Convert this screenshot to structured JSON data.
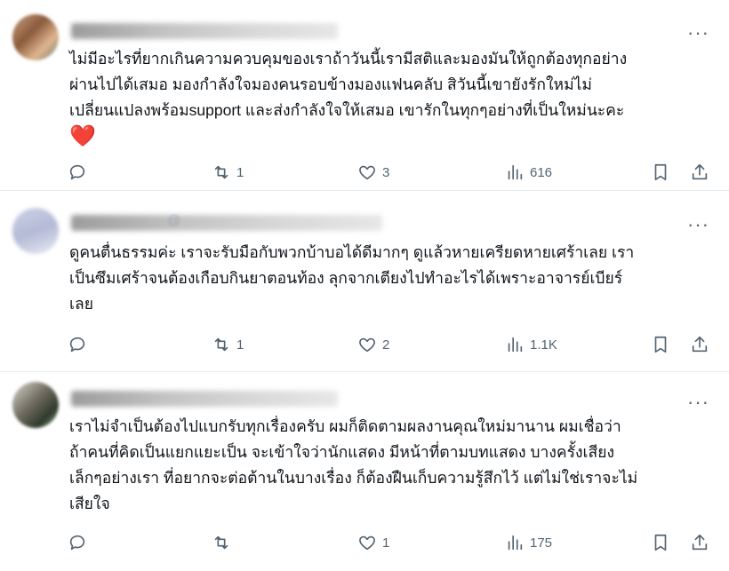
{
  "replies": [
    {
      "text": "ไม่มีอะไรที่ยากเกินความควบคุมของเราถ้าวันนี้เรามีสติและมองมันให้ถูกต้องทุกอย่าง\nผ่านไปได้เสมอ มองกำลังใจมองคนรอบข้างมองแฟนคลับ สิวันนี้เขายังรักใหม่ไม่\nเปลี่ยนแปลงพร้อมsupport และส่งกำลังใจให้เสมอ เขารักในทุกๆอย่างที่เป็นใหม่นะคะ",
      "emoji": "❤️",
      "counts": {
        "replies": "",
        "retweets": "1",
        "likes": "3",
        "views": "616"
      }
    },
    {
      "handle": "@",
      "text": "ดูคนตื่นธรรมค่ะ เราจะรับมือกับพวกบ้าบอได้ดีมากๆ ดูแล้วหายเครียดหายเศร้าเลย เรา\nเป็นซึมเศร้าจนต้องเกือบกินยาตอนท้อง ลุกจากเตียงไปทำอะไรได้เพราะอาจารย์เบียร์\nเลย",
      "counts": {
        "replies": "",
        "retweets": "1",
        "likes": "2",
        "views": "1.1K"
      }
    },
    {
      "text": "เราไม่จำเป็นต้องไปแบกรับทุกเรื่องครับ ผมก็ติดตามผลงานคุณใหม่มานาน ผมเชื่อว่า\nถ้าคนที่คิดเป็นแยกแยะเป็น จะเข้าใจว่านักแสดง มีหน้าที่ตามบทแสดง บางครั้งเสียง\nเล็กๆอย่างเรา ที่อยากจะต่อต้านในบางเรื่อง ก็ต้องฝืนเก็บความรู้สึกไว้ แต่ไม่ใช่เราจะไม่\nเสียใจ",
      "counts": {
        "replies": "",
        "retweets": "",
        "likes": "1",
        "views": "175"
      }
    }
  ],
  "more_label": "···",
  "icons": [
    "reply-icon",
    "retweet-icon",
    "like-icon",
    "views-icon",
    "bookmark-icon",
    "share-icon"
  ]
}
